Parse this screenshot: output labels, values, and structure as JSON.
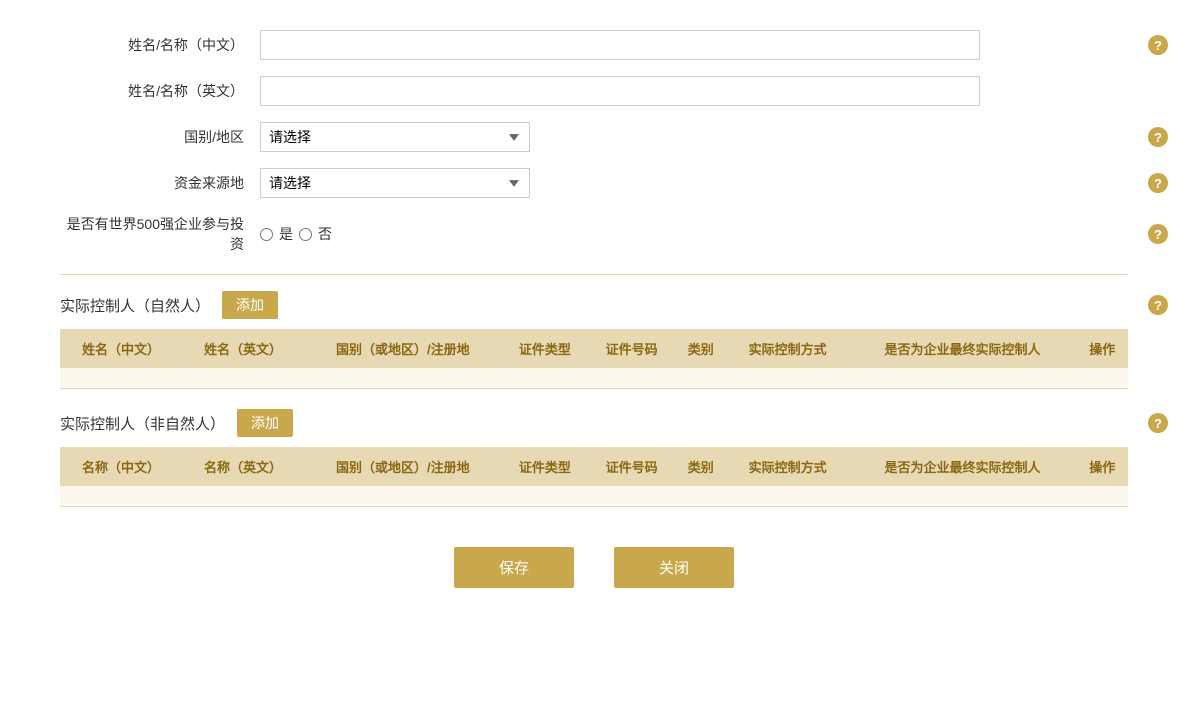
{
  "form": {
    "name_cn_label": "姓名/名称（中文）",
    "name_en_label": "姓名/名称（英文）",
    "country_label": "国别/地区",
    "country_placeholder": "请选择",
    "fund_source_label": "资金来源地",
    "fund_source_placeholder": "请选择",
    "fortune500_label": "是否有世界500强企业参与投资",
    "radio_yes": "是",
    "radio_no": "否"
  },
  "natural_section": {
    "title": "实际控制人（自然人）",
    "add_btn": "添加",
    "columns": [
      "姓名（中文）",
      "姓名（英文）",
      "国别（或地区）/注册地",
      "证件类型",
      "证件号码",
      "类别",
      "实际控制方式",
      "是否为企业最终实际控制人",
      "操作"
    ]
  },
  "non_natural_section": {
    "title": "实际控制人（非自然人）",
    "add_btn": "添加",
    "columns": [
      "名称（中文）",
      "名称（英文）",
      "国别（或地区）/注册地",
      "证件类型",
      "证件号码",
      "类别",
      "实际控制方式",
      "是否为企业最终实际控制人",
      "操作"
    ]
  },
  "buttons": {
    "save": "保存",
    "close": "关闭"
  },
  "help_icon": "?",
  "colors": {
    "gold": "#c9a84c",
    "table_header_bg": "#e8d9b5",
    "table_header_text": "#8b6914"
  }
}
